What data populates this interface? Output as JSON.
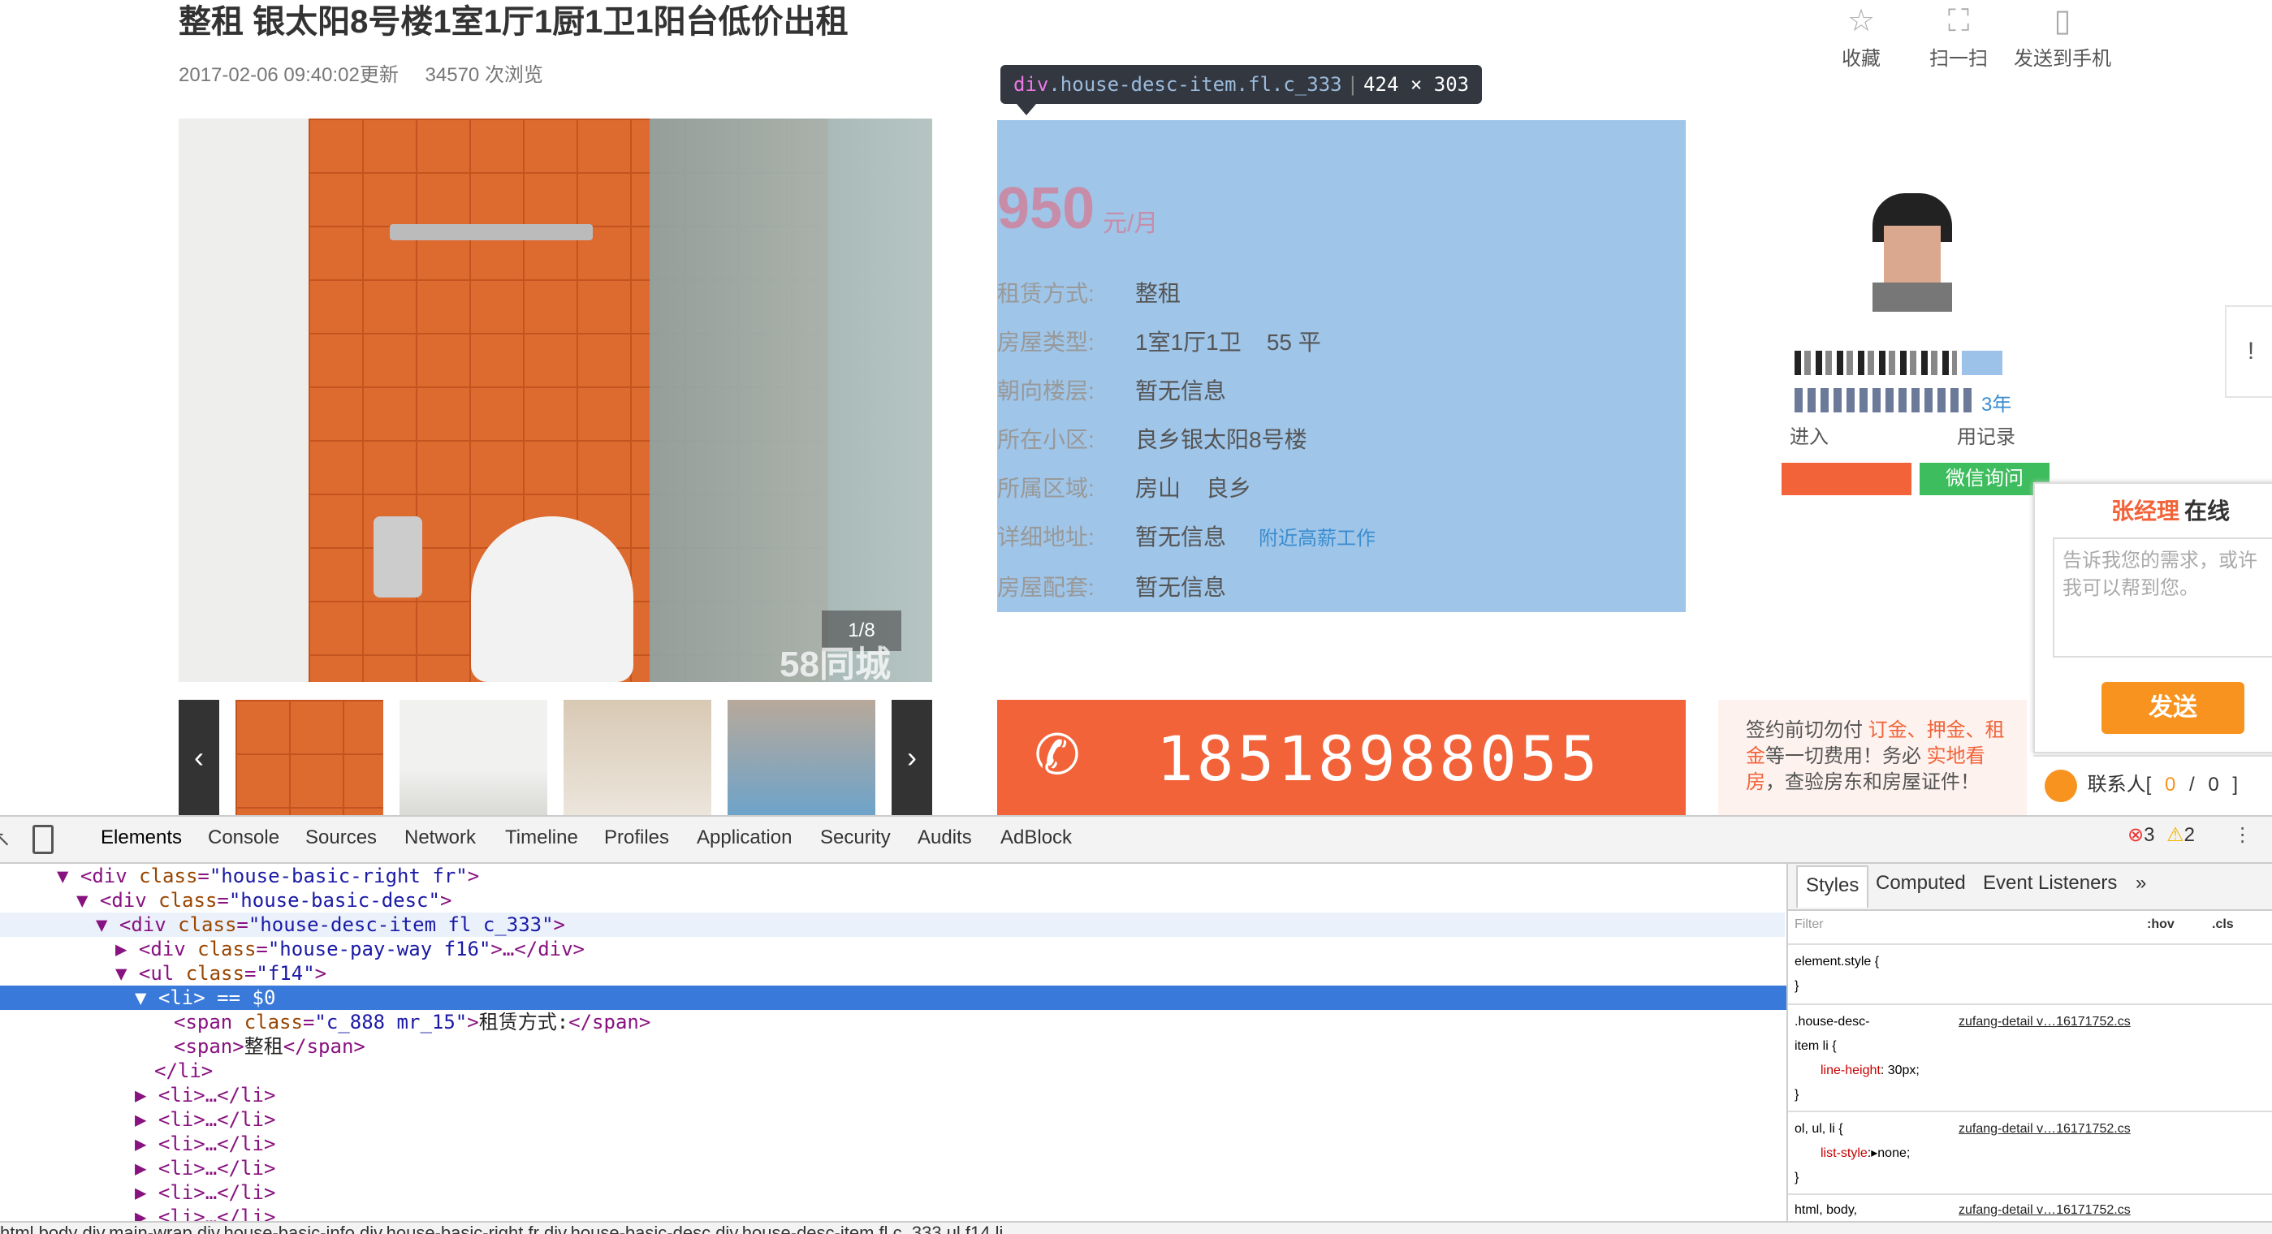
{
  "page": {
    "title": "整租 银太阳8号楼1室1厅1厨1卫1阳台低价出租",
    "updated": "2017-02-06 09:40:02更新",
    "views": "34570 次浏览",
    "actions": [
      {
        "label": "收藏",
        "icon": "star-icon"
      },
      {
        "label": "扫一扫",
        "icon": "scan-icon"
      },
      {
        "label": "发送到手机",
        "icon": "phone-icon"
      }
    ],
    "photo_counter": "1/8",
    "watermark": "58同城"
  },
  "tooltip": {
    "tag": "div",
    "classes": ".house-desc-item.fl.c_333",
    "size": "424 × 303"
  },
  "desc": {
    "price": "950",
    "unit": "元/月",
    "rows": [
      {
        "k": "租赁方式:",
        "v": "整租"
      },
      {
        "k": "房屋类型:",
        "v": "1室1厅1卫    55 平"
      },
      {
        "k": "朝向楼层:",
        "v": "暂无信息"
      },
      {
        "k": "所在小区:",
        "v": "良乡银太阳8号楼"
      },
      {
        "k": "所属区域:",
        "v": "房山    良乡"
      },
      {
        "k": "详细地址:",
        "v": "暂无信息",
        "link": "附近高薪工作"
      },
      {
        "k": "房屋配套:",
        "v": "暂无信息"
      }
    ],
    "phone": "18518988055"
  },
  "warning": {
    "p1": "签约前切勿付 ",
    "r1": "订金、押金、租金",
    "p2": "等一切费用！务必 ",
    "r2": "实地看房",
    "p3": "，查验房东和房屋证件！"
  },
  "agent": {
    "years": "3年",
    "record_text": "进入",
    "record_tail": "用记录",
    "wechat": "微信询问"
  },
  "chat": {
    "name": "张经理",
    "status": "在线",
    "placeholder": "告诉我您的需求，或许我可以帮到您。",
    "send": "发送",
    "contacts_label": "联系人[",
    "contacts_a": "0",
    "contacts_sep": "/",
    "contacts_b": "0",
    "contacts_end": "]"
  },
  "devtools": {
    "tabs": [
      "Elements",
      "Console",
      "Sources",
      "Network",
      "Timeline",
      "Profiles",
      "Application",
      "Security",
      "Audits",
      "AdBlock"
    ],
    "errors": "3",
    "warnings": "2",
    "side_tabs": [
      "Styles",
      "Computed",
      "Event Listeners",
      "»"
    ],
    "filter_placeholder": "Filter",
    "hov": ":hov",
    "cls": ".cls",
    "element_style": "element.style {",
    "close_brace": "}",
    "rule1_selector": ".house-desc-",
    "rule1_selector2": "item li {",
    "rule1_link": "zufang-detail v…16171752.cs",
    "rule1_prop": "line-height",
    "rule1_val": " 30px;",
    "rule2_selector": "ol, ul, li {",
    "rule2_link": "zufang-detail v…16171752.cs",
    "rule2_prop": "list-style",
    "rule2_val": "▸none;",
    "rule3_selector": "html, body,",
    "rule3_link": "zufang-detail v…16171752.cs",
    "breadcrumb": "html  body  div.main-wrap  div.house-basic-info  div.house-basic-right.fr  div.house-basic-desc  div.house-desc-item.fl.c_333  ul.f14  li"
  }
}
